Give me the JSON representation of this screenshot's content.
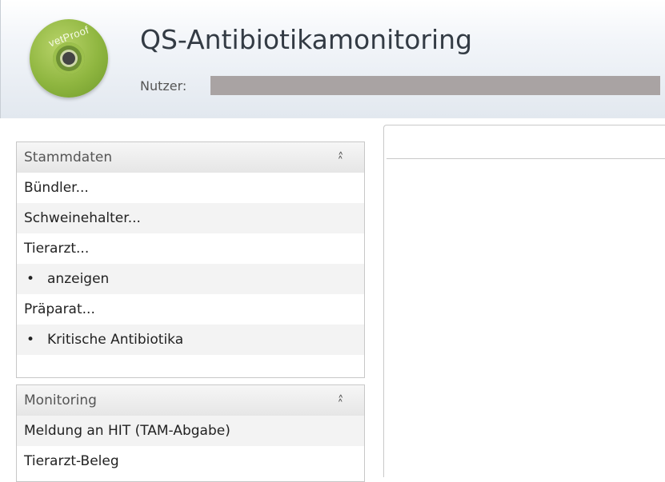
{
  "header": {
    "logo_text": "vetProof",
    "title": "QS-Antibiotikamonitoring",
    "user_label": "Nutzer:"
  },
  "sidebar": {
    "stammdaten": {
      "title": "Stammdaten",
      "collapse_icon": "double-chevron-up-icon",
      "items": [
        {
          "label": "Bündler...",
          "type": "header"
        },
        {
          "label": "Schweinehalter...",
          "type": "header"
        },
        {
          "label": "Tierarzt...",
          "type": "header"
        },
        {
          "label": "anzeigen",
          "type": "sub",
          "bullet": "•"
        },
        {
          "label": "Präparat...",
          "type": "header"
        },
        {
          "label": "Kritische Antibiotika",
          "type": "sub",
          "bullet": "•"
        }
      ]
    },
    "monitoring": {
      "title": "Monitoring",
      "collapse_icon": "double-chevron-up-icon",
      "items": [
        {
          "label": "Meldung an HIT (TAM-Abgabe)",
          "type": "header"
        },
        {
          "label": "Tierarzt-Beleg",
          "type": "header"
        }
      ]
    }
  },
  "colors": {
    "logo_green": "#8fb640",
    "title_text": "#333b44",
    "redaction": "#a9a3a3",
    "alt_row": "#f3f3f3"
  }
}
